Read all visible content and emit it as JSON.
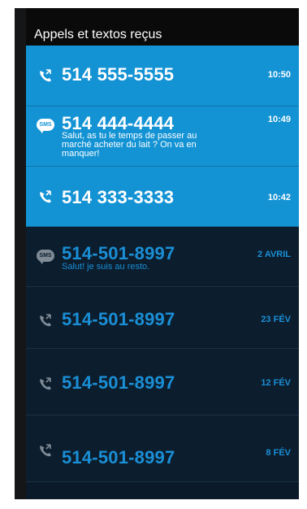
{
  "header": {
    "title": "Appels et textos reçus"
  },
  "items": [
    {
      "kind": "call",
      "status": "new",
      "number": "514 555-5555",
      "time": "10:50",
      "message": "",
      "icon": "phone-icon"
    },
    {
      "kind": "sms",
      "status": "new",
      "number": "514 444-4444",
      "time": "10:49",
      "icon": "sms-icon",
      "icon_text": "SMS",
      "message_lines": [
        "Salut, as tu le temps de passer au",
        "marché acheter du lait ? On va en",
        "manquer!"
      ]
    },
    {
      "kind": "call",
      "status": "new",
      "number": "514 333-3333",
      "time": "10:42",
      "message": "",
      "icon": "phone-icon"
    },
    {
      "kind": "sms",
      "status": "old",
      "number": "514-501-8997",
      "time": "2 AVRIL",
      "icon": "sms-icon",
      "icon_text": "SMS",
      "message_lines": [
        "Salut! je suis au resto."
      ]
    },
    {
      "kind": "call",
      "status": "old",
      "number": "514-501-8997",
      "time": "23 FÉV",
      "message": "",
      "icon": "phone-icon"
    },
    {
      "kind": "call",
      "status": "old",
      "number": "514-501-8997",
      "time": "12 FÉV",
      "message": "",
      "icon": "phone-icon"
    },
    {
      "kind": "call",
      "status": "old",
      "number": "514-501-8997",
      "time": "8 FÉV",
      "message": "",
      "icon": "phone-icon"
    }
  ],
  "colors": {
    "new_background": "#1493d4",
    "old_background": "#0c1d2d",
    "old_text": "#1a8fd6",
    "header_background": "#0a0a0b"
  }
}
